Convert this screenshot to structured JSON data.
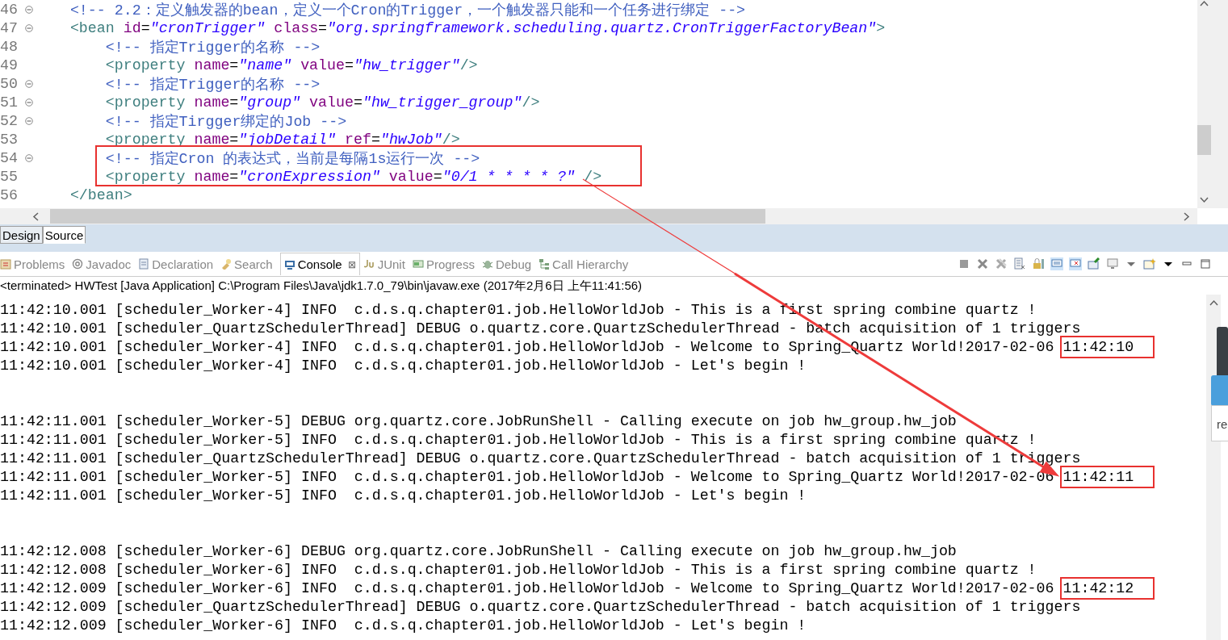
{
  "editor": {
    "lines": [
      {
        "number": "46",
        "fold": true,
        "marked": false,
        "segments": [
          {
            "kind": "comment",
            "text": "    <!-- 2.2：定义触发器的bean，定义一个Cron的Trigger，一个触发器只能和一个任务进行绑定 -->"
          }
        ]
      },
      {
        "number": "47",
        "fold": true,
        "marked": false,
        "segments": [
          {
            "kind": "tag",
            "text": "    <bean"
          },
          {
            "kind": "attr",
            "text": " id"
          },
          {
            "kind": "eq",
            "text": "="
          },
          {
            "kind": "value",
            "text": "\"cronTrigger\""
          },
          {
            "kind": "attr",
            "text": " class"
          },
          {
            "kind": "eq",
            "text": "="
          },
          {
            "kind": "value",
            "text": "\"org.springframework.scheduling.quartz.CronTriggerFactoryBean\""
          },
          {
            "kind": "tag",
            "text": ">"
          }
        ]
      },
      {
        "number": "48",
        "fold": false,
        "marked": false,
        "segments": [
          {
            "kind": "comment",
            "text": "        <!-- 指定Trigger的名称 -->"
          }
        ]
      },
      {
        "number": "49",
        "fold": false,
        "marked": false,
        "segments": [
          {
            "kind": "tag",
            "text": "        <property"
          },
          {
            "kind": "attr",
            "text": " name"
          },
          {
            "kind": "eq",
            "text": "="
          },
          {
            "kind": "value",
            "text": "\"name\""
          },
          {
            "kind": "attr",
            "text": " value"
          },
          {
            "kind": "eq",
            "text": "="
          },
          {
            "kind": "value",
            "text": "\"hw_trigger\""
          },
          {
            "kind": "tag",
            "text": "/>"
          }
        ]
      },
      {
        "number": "50",
        "fold": true,
        "marked": false,
        "segments": [
          {
            "kind": "comment",
            "text": "        <!-- 指定Trigger的名称 -->"
          }
        ]
      },
      {
        "number": "51",
        "fold": true,
        "marked": false,
        "segments": [
          {
            "kind": "tag",
            "text": "        <property"
          },
          {
            "kind": "attr",
            "text": " name"
          },
          {
            "kind": "eq",
            "text": "="
          },
          {
            "kind": "value",
            "text": "\"group\""
          },
          {
            "kind": "attr",
            "text": " value"
          },
          {
            "kind": "eq",
            "text": "="
          },
          {
            "kind": "value",
            "text": "\"hw_trigger_group\""
          },
          {
            "kind": "tag",
            "text": "/>"
          }
        ]
      },
      {
        "number": "52",
        "fold": true,
        "marked": false,
        "segments": [
          {
            "kind": "comment",
            "text": "        <!-- 指定Tirgger绑定的Job -->"
          }
        ]
      },
      {
        "number": "53",
        "fold": false,
        "marked": false,
        "segments": [
          {
            "kind": "tag",
            "text": "        <property"
          },
          {
            "kind": "attr",
            "text": " name"
          },
          {
            "kind": "eq",
            "text": "="
          },
          {
            "kind": "value",
            "text": "\"jobDetail\""
          },
          {
            "kind": "attr",
            "text": " ref"
          },
          {
            "kind": "eq",
            "text": "="
          },
          {
            "kind": "value",
            "text": "\"hwJob\""
          },
          {
            "kind": "tag",
            "text": "/>"
          }
        ]
      },
      {
        "number": "54",
        "fold": true,
        "marked": true,
        "segments": [
          {
            "kind": "comment",
            "text": "        <!-- 指定Cron 的表达式，当前是每隔1s运行一次 -->"
          }
        ]
      },
      {
        "number": "55",
        "fold": false,
        "marked": true,
        "segments": [
          {
            "kind": "tag",
            "text": "        <property"
          },
          {
            "kind": "attr",
            "text": " name"
          },
          {
            "kind": "eq",
            "text": "="
          },
          {
            "kind": "value",
            "text": "\"cronExpression\""
          },
          {
            "kind": "attr",
            "text": " value"
          },
          {
            "kind": "eq",
            "text": "="
          },
          {
            "kind": "value",
            "text": "\"0/1 * * * * ?\""
          },
          {
            "kind": "tag",
            "text": " />"
          }
        ]
      },
      {
        "number": "56",
        "fold": false,
        "marked": false,
        "segments": [
          {
            "kind": "tag",
            "text": "    </bean>"
          }
        ]
      }
    ]
  },
  "editor_tabs": [
    {
      "label": "Design",
      "selected": false
    },
    {
      "label": "Source",
      "selected": true
    }
  ],
  "view_tabs": [
    {
      "label": "Problems",
      "selected": false
    },
    {
      "label": "Javadoc",
      "selected": false
    },
    {
      "label": "Declaration",
      "selected": false
    },
    {
      "label": "Search",
      "selected": false
    },
    {
      "label": "Console",
      "selected": true,
      "close": "⊠"
    },
    {
      "label": "JUnit",
      "selected": false
    },
    {
      "label": "Progress",
      "selected": false
    },
    {
      "label": "Debug",
      "selected": false
    },
    {
      "label": "Call Hierarchy",
      "selected": false
    }
  ],
  "console": {
    "status": "<terminated> HWTest [Java Application] C:\\Program Files\\Java\\jdk1.7.0_79\\bin\\javaw.exe (2017年2月6日 上午11:41:56)",
    "rows": [
      {
        "kind": "text",
        "text": "11:42:10.001 [scheduler_Worker-4] INFO  c.d.s.q.chapter01.job.HelloWorldJob - This is a first spring combine quartz !"
      },
      {
        "kind": "text",
        "text": "11:42:10.001 [scheduler_QuartzSchedulerThread] DEBUG o.quartz.core.QuartzSchedulerThread - batch acquisition of 1 triggers"
      },
      {
        "kind": "text",
        "text": "11:42:10.001 [scheduler_Worker-4] INFO  c.d.s.q.chapter01.job.HelloWorldJob - Welcome to Spring_Quartz World!2017-02-06 ",
        "highlight": "11:42:10"
      },
      {
        "kind": "text",
        "text": "11:42:10.001 [scheduler_Worker-4] INFO  c.d.s.q.chapter01.job.HelloWorldJob - Let's begin !"
      },
      {
        "kind": "blank"
      },
      {
        "kind": "blank"
      },
      {
        "kind": "text",
        "text": "11:42:11.001 [scheduler_Worker-5] DEBUG org.quartz.core.JobRunShell - Calling execute on job hw_group.hw_job"
      },
      {
        "kind": "text",
        "text": "11:42:11.001 [scheduler_Worker-5] INFO  c.d.s.q.chapter01.job.HelloWorldJob - This is a first spring combine quartz !"
      },
      {
        "kind": "text",
        "text": "11:42:11.001 [scheduler_QuartzSchedulerThread] DEBUG o.quartz.core.QuartzSchedulerThread - batch acquisition of 1 triggers"
      },
      {
        "kind": "text",
        "text": "11:42:11.001 [scheduler_Worker-5] INFO  c.d.s.q.chapter01.job.HelloWorldJob - Welcome to Spring_Quartz World!2017-02-06 ",
        "highlight": "11:42:11"
      },
      {
        "kind": "text",
        "text": "11:42:11.001 [scheduler_Worker-5] INFO  c.d.s.q.chapter01.job.HelloWorldJob - Let's begin !"
      },
      {
        "kind": "blank"
      },
      {
        "kind": "blank"
      },
      {
        "kind": "text",
        "text": "11:42:12.008 [scheduler_Worker-6] DEBUG org.quartz.core.JobRunShell - Calling execute on job hw_group.hw_job"
      },
      {
        "kind": "text",
        "text": "11:42:12.008 [scheduler_Worker-6] INFO  c.d.s.q.chapter01.job.HelloWorldJob - This is a first spring combine quartz !"
      },
      {
        "kind": "text",
        "text": "11:42:12.009 [scheduler_Worker-6] INFO  c.d.s.q.chapter01.job.HelloWorldJob - Welcome to Spring_Quartz World!2017-02-06 ",
        "highlight": "11:42:12"
      },
      {
        "kind": "text",
        "text": "11:42:12.009 [scheduler_QuartzSchedulerThread] DEBUG o.quartz.core.QuartzSchedulerThread - batch acquisition of 1 triggers"
      },
      {
        "kind": "text",
        "text": "11:42:12.009 [scheduler_Worker-6] INFO  c.d.s.q.chapter01.job.HelloWorldJob - Let's begin !"
      }
    ]
  },
  "side_window": {
    "text": "re"
  }
}
